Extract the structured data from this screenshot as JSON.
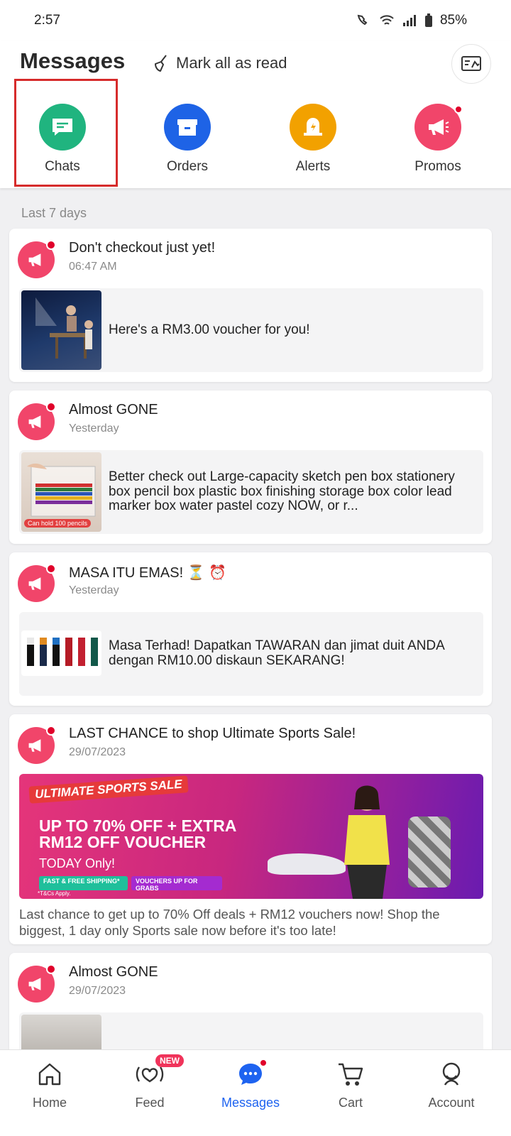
{
  "status_bar": {
    "time": "2:57",
    "battery": "85%"
  },
  "header": {
    "title": "Messages",
    "mark_all_read": "Mark all as read"
  },
  "categories": [
    {
      "label": "Chats",
      "color": "#20b47f",
      "icon": "chat-icon"
    },
    {
      "label": "Orders",
      "color": "#1e63e6",
      "icon": "box-icon"
    },
    {
      "label": "Alerts",
      "color": "#f2a100",
      "icon": "alert-bell-icon"
    },
    {
      "label": "Promos",
      "color": "#f1456a",
      "icon": "megaphone-icon",
      "has_dot": true
    }
  ],
  "section_label": "Last 7 days",
  "messages": [
    {
      "title": "Don't checkout just yet!",
      "time": "06:47 AM",
      "snippet": "Here's a RM3.00 voucher for you!"
    },
    {
      "title": "Almost GONE",
      "time": "Yesterday",
      "snippet": "Better check out Large-capacity sketch pen box stationery box pencil box plastic box finishing storage box color lead marker box water pastel cozy NOW, or r...",
      "thumb_caption": "Can hold 100 pencils"
    },
    {
      "title": "MASA ITU EMAS! ⏳ ⏰",
      "time": "Yesterday",
      "snippet": "Masa Terhad! Dapatkan TAWARAN dan jimat duit ANDA dengan RM10.00 diskaun SEKARANG!"
    },
    {
      "title": "LAST CHANCE to shop Ultimate Sports Sale!",
      "time": "29/07/2023",
      "banner": {
        "badge": "ULTIMATE SPORTS SALE",
        "line1": "UP TO 70% OFF + EXTRA",
        "line2": "RM12 OFF VOUCHER",
        "line3": "TODAY Only!",
        "tag1": "FAST & FREE SHIPPING*",
        "tag2": "VOUCHERS UP FOR GRABS",
        "terms": "*T&Cs Apply."
      },
      "description": "Last chance to get up to 70% Off deals + RM12 vouchers now! Shop the biggest, 1 day only Sports sale now before it's too late!"
    },
    {
      "title": "Almost GONE",
      "time": "29/07/2023"
    }
  ],
  "bottom_nav": [
    {
      "label": "Home",
      "icon": "home-icon"
    },
    {
      "label": "Feed",
      "icon": "feed-live-icon",
      "badge": "NEW"
    },
    {
      "label": "Messages",
      "icon": "message-bubble-icon",
      "active": true
    },
    {
      "label": "Cart",
      "icon": "cart-icon"
    },
    {
      "label": "Account",
      "icon": "account-icon"
    }
  ]
}
